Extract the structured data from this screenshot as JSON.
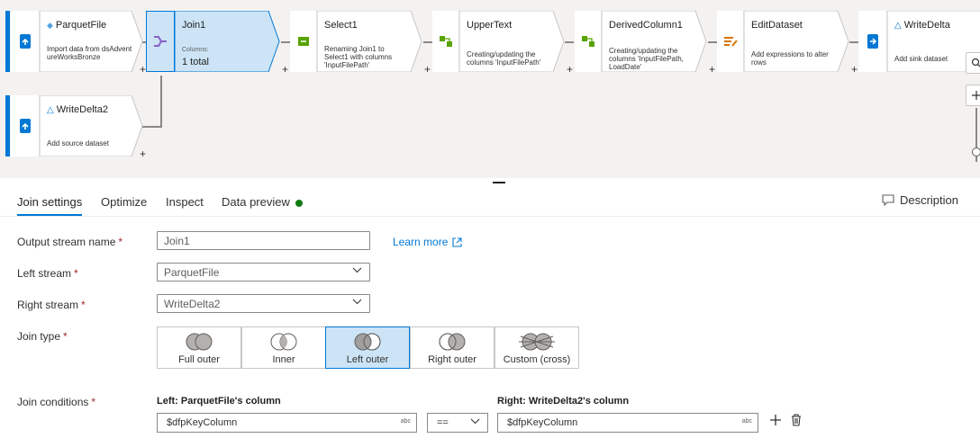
{
  "canvas": {
    "nodes": {
      "parquet": {
        "title": "ParquetFile",
        "desc": "Import data from dsAdventureWorksBronze"
      },
      "join1": {
        "title": "Join1",
        "columns_label": "Columns:",
        "columns_value": "1 total"
      },
      "select1": {
        "title": "Select1",
        "desc": "Renaming Join1 to Select1 with columns 'InputFilePath'"
      },
      "upper": {
        "title": "UpperText",
        "desc": "Creating/updating the columns 'InputFilePath'"
      },
      "derived": {
        "title": "DerivedColumn1",
        "desc": "Creating/updating the columns 'InputFilePath, LoadDate'"
      },
      "edit": {
        "title": "EditDataset",
        "desc": "Add expressions to alter rows"
      },
      "writedelta": {
        "title": "WriteDelta",
        "desc": "Add sink dataset"
      },
      "writedelta2": {
        "title": "WriteDelta2",
        "desc": "Add source dataset"
      }
    },
    "plus": "+"
  },
  "tabs": [
    {
      "label": "Join settings"
    },
    {
      "label": "Optimize"
    },
    {
      "label": "Inspect"
    },
    {
      "label": "Data preview"
    }
  ],
  "description_button": "Description",
  "form": {
    "output_stream": {
      "label": "Output stream name",
      "value": "Join1"
    },
    "learn_more": "Learn more",
    "left_stream": {
      "label": "Left stream",
      "value": "ParquetFile"
    },
    "right_stream": {
      "label": "Right stream",
      "value": "WriteDelta2"
    },
    "join_type": {
      "label": "Join type",
      "options": [
        "Full outer",
        "Inner",
        "Left outer",
        "Right outer",
        "Custom (cross)"
      ],
      "selected": "Left outer"
    },
    "join_conditions": {
      "label": "Join conditions",
      "left_header": "Left: ParquetFile's column",
      "right_header": "Right: WriteDelta2's column",
      "left_value": "$dfpKeyColumn",
      "operator": "==",
      "right_value": "$dfpKeyColumn",
      "type_badge": "abc"
    },
    "required_mark": "*"
  },
  "colors": {
    "accent": "#0078d4",
    "selected_bg": "#cce4f6",
    "preview_dot": "#107c10",
    "required": "#a4262c"
  }
}
